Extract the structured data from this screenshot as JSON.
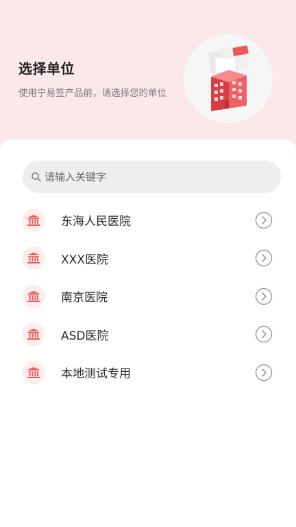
{
  "header": {
    "title": "选择单位",
    "subtitle": "使用宁易签产品前，请选择您的单位",
    "hero_icon": "hospital-building-illustration"
  },
  "search": {
    "placeholder": "请输入关键字",
    "value": "",
    "icon": "search-icon"
  },
  "units": [
    {
      "label": "东海人民医院",
      "icon": "institution-icon"
    },
    {
      "label": "XXX医院",
      "icon": "institution-icon"
    },
    {
      "label": "南京医院",
      "icon": "institution-icon"
    },
    {
      "label": "ASD医院",
      "icon": "institution-icon"
    },
    {
      "label": "本地测试专用",
      "icon": "institution-icon"
    }
  ],
  "colors": {
    "header_bg": "#fbe9ea",
    "accent": "#e85a5a",
    "badge_bg": "#fdeeee"
  }
}
